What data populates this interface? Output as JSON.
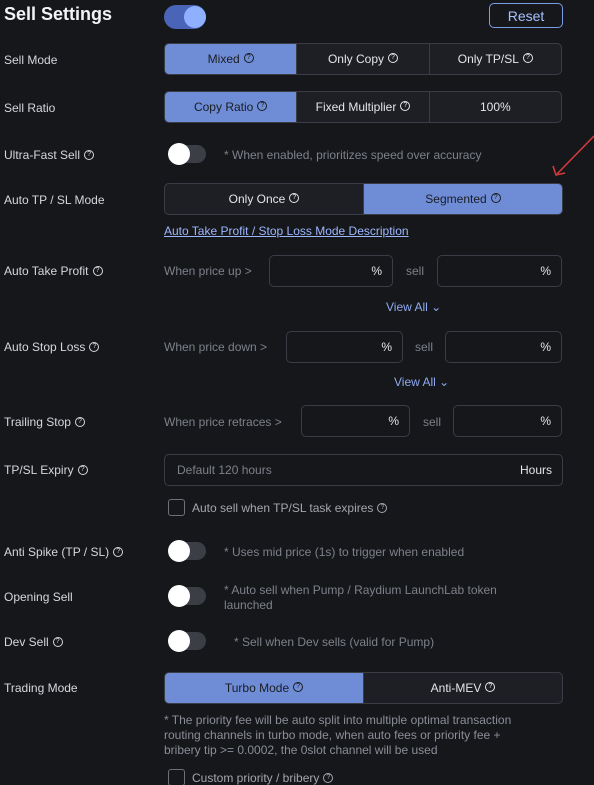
{
  "header": {
    "title": "Sell Settings",
    "reset_label": "Reset"
  },
  "sell_mode": {
    "label": "Sell Mode",
    "options": [
      "Mixed",
      "Only Copy",
      "Only TP/SL"
    ]
  },
  "sell_ratio": {
    "label": "Sell Ratio",
    "options": [
      "Copy Ratio",
      "Fixed Multiplier",
      "100%"
    ]
  },
  "ultra_fast": {
    "label": "Ultra-Fast Sell",
    "hint": "* When enabled, prioritizes speed over accuracy"
  },
  "auto_tpsl_mode": {
    "label": "Auto TP / SL Mode",
    "options": [
      "Only Once",
      "Segmented"
    ],
    "link": "Auto Take Profit / Stop Loss Mode Description"
  },
  "take_profit": {
    "label": "Auto Take Profit",
    "when": "When price up >",
    "unit": "%",
    "sell": "sell",
    "sell_unit": "%",
    "view_all": "View All"
  },
  "stop_loss": {
    "label": "Auto Stop Loss",
    "when": "When price down >",
    "unit": "%",
    "sell": "sell",
    "sell_unit": "%",
    "view_all": "View All"
  },
  "trailing": {
    "label": "Trailing Stop",
    "when": "When price retraces >",
    "unit": "%",
    "sell": "sell",
    "sell_unit": "%"
  },
  "expiry": {
    "label": "TP/SL Expiry",
    "placeholder": "Default 120 hours",
    "unit": "Hours",
    "checkbox_label": "Auto sell when TP/SL task expires"
  },
  "anti_spike": {
    "label": "Anti Spike (TP / SL)",
    "hint": "* Uses mid price (1s) to trigger when enabled"
  },
  "opening_sell": {
    "label": "Opening Sell",
    "hint_line1": "* Auto sell when Pump / Raydium LaunchLab token",
    "hint_line2": "launched"
  },
  "dev_sell": {
    "label": "Dev Sell",
    "hint": "* Sell when Dev sells (valid for Pump)"
  },
  "trading_mode": {
    "label": "Trading Mode",
    "options": [
      "Turbo Mode",
      "Anti-MEV"
    ],
    "note_line1": "* The priority fee will be auto split into multiple optimal transaction",
    "note_line2": "routing channels in turbo mode, when auto fees or priority fee +",
    "note_line3": "bribery tip >= 0.0002, the 0slot channel will be used",
    "checkbox_label": "Custom priority / bribery"
  },
  "colors": {
    "accent": "#6f8dd6",
    "background": "#16171b",
    "annotation_arrow": "#d33a3a"
  }
}
